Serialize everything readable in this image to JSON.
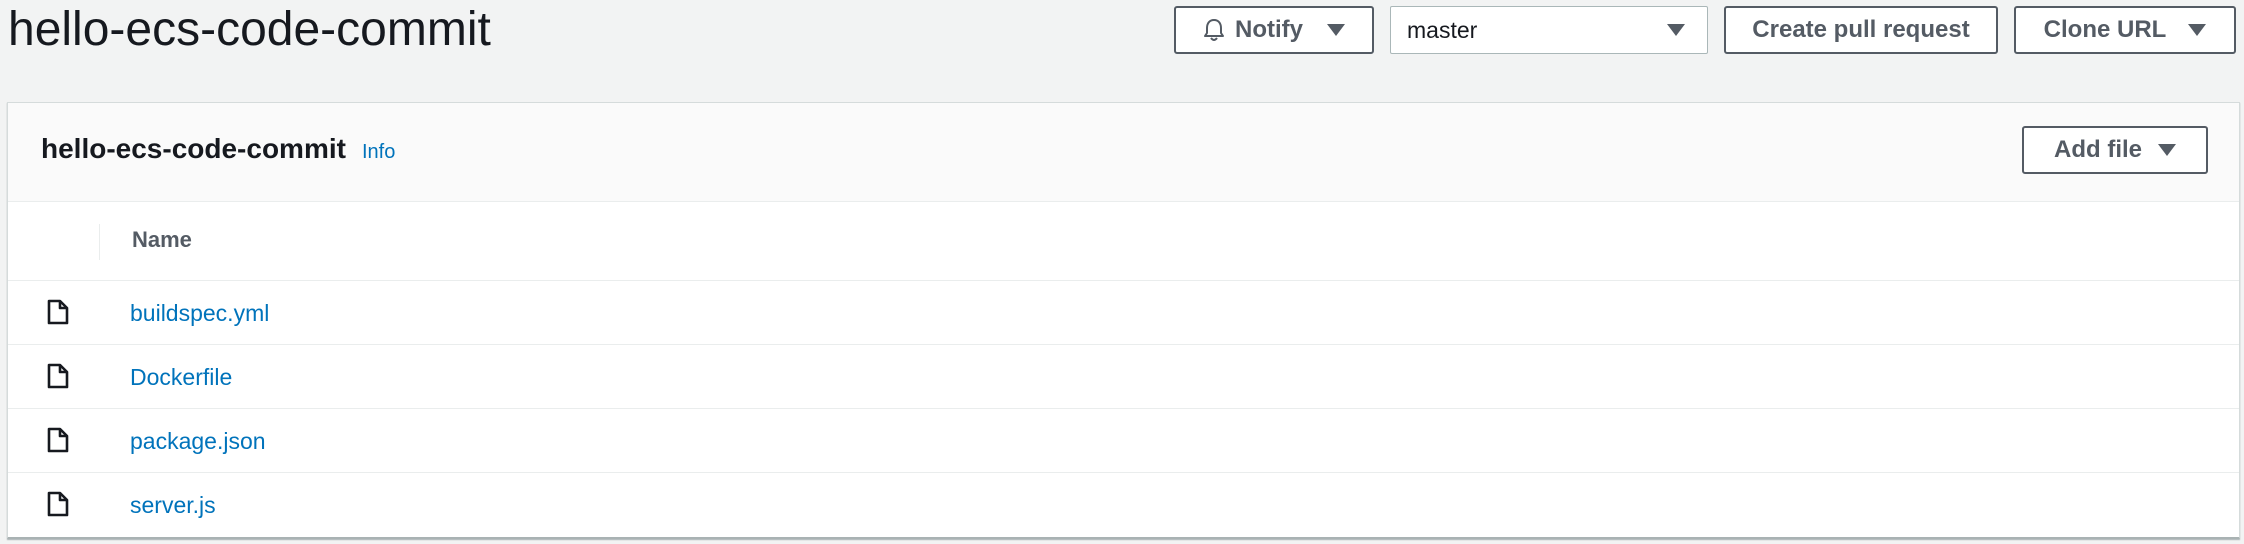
{
  "page": {
    "title": "hello-ecs-code-commit"
  },
  "header_actions": {
    "notify_label": "Notify",
    "branch_selected": "master",
    "create_pr_label": "Create pull request",
    "clone_url_label": "Clone URL"
  },
  "panel": {
    "title": "hello-ecs-code-commit",
    "info_label": "Info",
    "add_file_label": "Add file",
    "columns": [
      "Name"
    ],
    "files": [
      {
        "name": "buildspec.yml",
        "icon": "file-icon"
      },
      {
        "name": "Dockerfile",
        "icon": "file-icon"
      },
      {
        "name": "package.json",
        "icon": "file-icon"
      },
      {
        "name": "server.js",
        "icon": "file-icon"
      }
    ]
  },
  "colors": {
    "background": "#f2f3f3",
    "link": "#0073bb",
    "button_text": "#545b64",
    "text": "#16191f"
  }
}
